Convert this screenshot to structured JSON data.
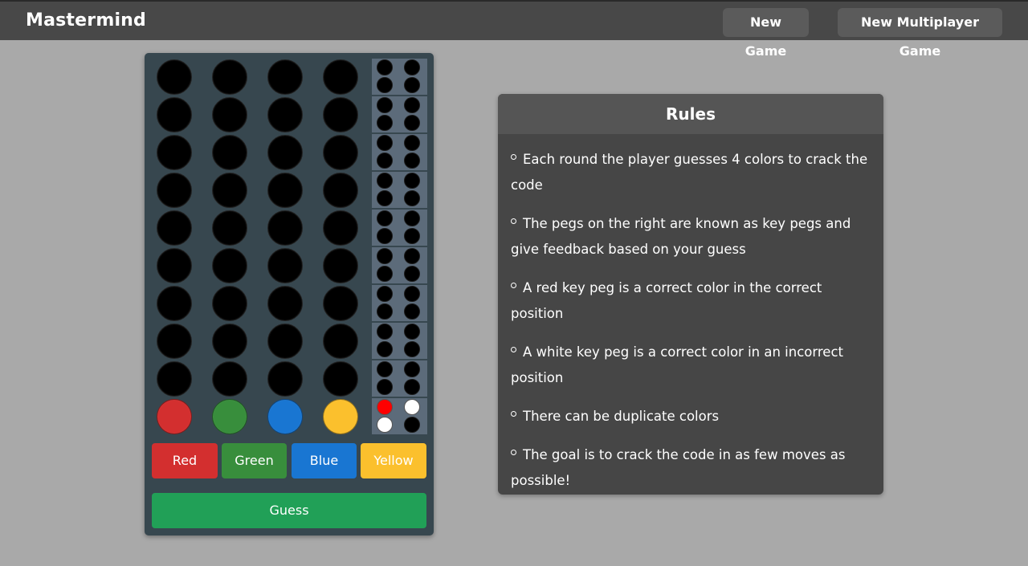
{
  "app": {
    "title": "Mastermind",
    "new_game_label": "New Game",
    "new_multiplayer_label": "New Multiplayer Game"
  },
  "board": {
    "rows": [
      {
        "pegs": [
          "empty",
          "empty",
          "empty",
          "empty"
        ],
        "keys": [
          "empty",
          "empty",
          "empty",
          "empty"
        ]
      },
      {
        "pegs": [
          "empty",
          "empty",
          "empty",
          "empty"
        ],
        "keys": [
          "empty",
          "empty",
          "empty",
          "empty"
        ]
      },
      {
        "pegs": [
          "empty",
          "empty",
          "empty",
          "empty"
        ],
        "keys": [
          "empty",
          "empty",
          "empty",
          "empty"
        ]
      },
      {
        "pegs": [
          "empty",
          "empty",
          "empty",
          "empty"
        ],
        "keys": [
          "empty",
          "empty",
          "empty",
          "empty"
        ]
      },
      {
        "pegs": [
          "empty",
          "empty",
          "empty",
          "empty"
        ],
        "keys": [
          "empty",
          "empty",
          "empty",
          "empty"
        ]
      },
      {
        "pegs": [
          "empty",
          "empty",
          "empty",
          "empty"
        ],
        "keys": [
          "empty",
          "empty",
          "empty",
          "empty"
        ]
      },
      {
        "pegs": [
          "empty",
          "empty",
          "empty",
          "empty"
        ],
        "keys": [
          "empty",
          "empty",
          "empty",
          "empty"
        ]
      },
      {
        "pegs": [
          "empty",
          "empty",
          "empty",
          "empty"
        ],
        "keys": [
          "empty",
          "empty",
          "empty",
          "empty"
        ]
      },
      {
        "pegs": [
          "empty",
          "empty",
          "empty",
          "empty"
        ],
        "keys": [
          "empty",
          "empty",
          "empty",
          "empty"
        ]
      },
      {
        "pegs": [
          "red",
          "green",
          "blue",
          "yellow"
        ],
        "keys": [
          "red",
          "white",
          "white",
          "empty"
        ]
      }
    ],
    "peg_colors": {
      "empty": "#000000",
      "red": "#d32f2f",
      "green": "#388e3c",
      "blue": "#1976d2",
      "yellow": "#fbc02d",
      "white": "#ffffff",
      "key_red": "#ff0000"
    },
    "color_buttons": [
      {
        "label": "Red",
        "color": "#d32f2f"
      },
      {
        "label": "Green",
        "color": "#388e3c"
      },
      {
        "label": "Blue",
        "color": "#1976d2"
      },
      {
        "label": "Yellow",
        "color": "#fbc02d"
      }
    ],
    "guess_label": "Guess"
  },
  "rules": {
    "title": "Rules",
    "items": [
      "Each round the player guesses 4 colors to crack the code",
      "The pegs on the right are known as key pegs and give feedback based on your guess",
      "A red key peg is a correct color in the correct position",
      "A white key peg is a correct color in an incorrect position",
      "There can be duplicate colors",
      "The goal is to crack the code in as few moves as possible!"
    ]
  }
}
